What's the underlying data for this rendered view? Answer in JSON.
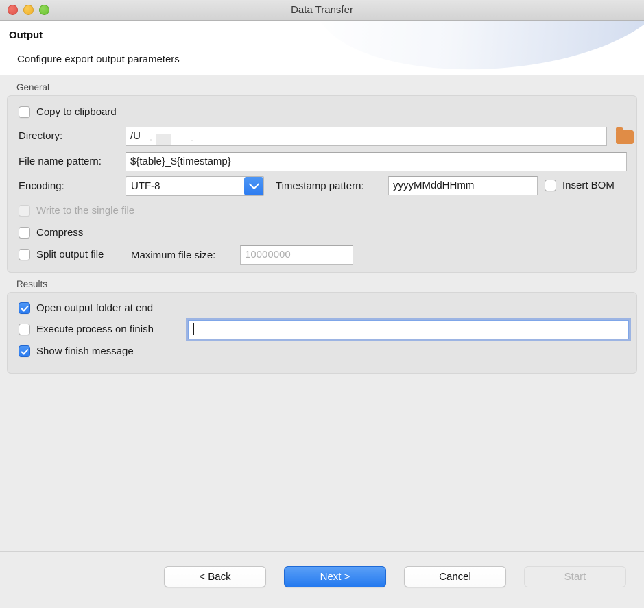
{
  "window": {
    "title": "Data Transfer",
    "traffic_lights": [
      "close-button",
      "minimize-button",
      "maximize-button"
    ]
  },
  "header": {
    "title": "Output",
    "subtitle": "Configure export output parameters"
  },
  "general": {
    "group_label": "General",
    "copy_to_clipboard": {
      "label": "Copy to clipboard",
      "checked": false
    },
    "directory": {
      "label": "Directory:",
      "value": "/U",
      "browse_icon": "folder-icon"
    },
    "file_name_pattern": {
      "label": "File name pattern:",
      "value": "${table}_${timestamp}"
    },
    "encoding": {
      "label": "Encoding:",
      "value": "UTF-8",
      "dropdown_icon": "chevron-down-icon"
    },
    "timestamp_pattern": {
      "label": "Timestamp pattern:",
      "value": "yyyyMMddHHmm"
    },
    "insert_bom": {
      "label": "Insert BOM",
      "checked": false
    },
    "write_single_file": {
      "label": "Write to the single file",
      "checked": false,
      "disabled": true
    },
    "compress": {
      "label": "Compress",
      "checked": false
    },
    "split_output_file": {
      "label": "Split output file",
      "checked": false
    },
    "maximum_file_size": {
      "label": "Maximum file size:",
      "value": "10000000",
      "disabled": true
    }
  },
  "results": {
    "group_label": "Results",
    "open_output_folder": {
      "label": "Open output folder at end",
      "checked": true
    },
    "execute_process": {
      "label": "Execute process on finish",
      "checked": false,
      "value": "",
      "focused": true
    },
    "show_finish_message": {
      "label": "Show finish message",
      "checked": true
    }
  },
  "footer": {
    "back_label": "< Back",
    "next_label": "Next >",
    "cancel_label": "Cancel",
    "start_label": "Start"
  },
  "colors": {
    "accent": "#2479ef",
    "folder": "#e08c46",
    "panel": "#e4e4e4",
    "background": "#ececec"
  }
}
